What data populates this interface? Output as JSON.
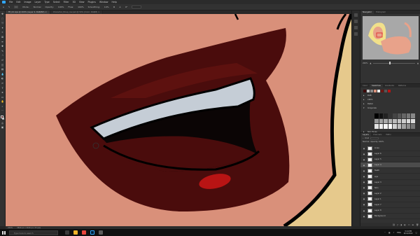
{
  "menubar": {
    "app_icon": "photoshop-logo",
    "items": [
      "File",
      "Edit",
      "Image",
      "Layer",
      "Type",
      "Select",
      "Filter",
      "3D",
      "View",
      "Plugins",
      "Window",
      "Help"
    ]
  },
  "options": {
    "mode_label": "Mode:",
    "mode_value": "Normal",
    "opacity_label": "Opacity:",
    "opacity_value": "100%",
    "flow_label": "Flow:",
    "flow_value": "100%",
    "smoothing_label": "Smoothing:",
    "smoothing_value": "10%",
    "angle_value": "0°"
  },
  "doc_tabs": [
    {
      "label": "FP_04 Lips @ 200% (Layer 4, RGB/8#) ×",
      "active": true
    },
    {
      "label": "Character_Pinup_rev.psd @ 50% (Color, RGB/8) ×",
      "active": false
    }
  ],
  "status": {
    "zoom": "200%",
    "doc_info": "3840 px x 2160 px (72 ppi)"
  },
  "panels": {
    "nav_tabs": [
      "Navigator",
      "Histogram"
    ],
    "zoom_value": "200%",
    "swatch_tabs": [
      "Color",
      "Swatches",
      "Gradients",
      "Patterns"
    ],
    "swatch_groups": [
      "RGB",
      "CMYK",
      "Pastel",
      "Grayscale",
      "Skin Tones"
    ],
    "layer_tabs": [
      "Layers",
      "Channels",
      "Paths"
    ],
    "kind_label": "Kind",
    "blend_label": "Normal",
    "opacity_label": "Opacity: 100%",
    "lock_label": "Lock:",
    "fill_label": "Fill: 100%",
    "layers": [
      "Lines",
      "Layer 6",
      "Layer 5",
      "Layer 4",
      "Teeth",
      "Lips",
      "Layer 3",
      "Skin",
      "Layer 2",
      "Layer 1",
      "Layer 7",
      "Layer 8",
      "Background"
    ],
    "selected_layer_index": 3
  },
  "taskbar": {
    "search_placeholder": "Type here to search",
    "time": "3:14 PM",
    "date": "9/12/2022",
    "lang": "ENG"
  },
  "colors": {
    "canvas_bg": "#d9907a",
    "lip_dark": "#4a0c0c",
    "lip_mid": "#6d1512",
    "teeth": "#c5cdd6",
    "mouth_inner": "#0b0505",
    "highlight": "#b81414",
    "hair_yellow": "#e6c98c",
    "outline": "#000000"
  }
}
